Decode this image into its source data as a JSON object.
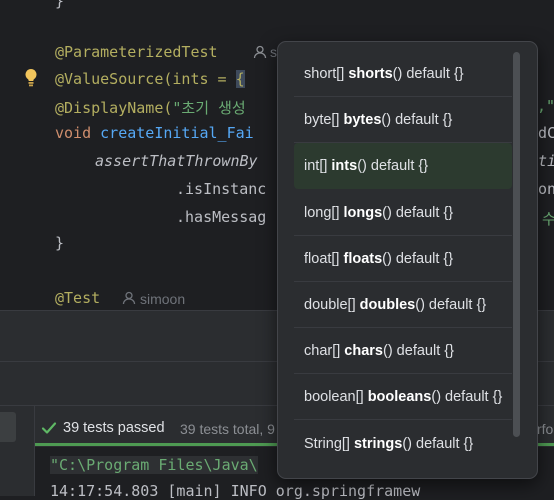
{
  "editor": {
    "lines": {
      "brace_close_top": "}",
      "param_test": "@ParameterizedTest",
      "value_source_prefix": "@ValueSource(ints = ",
      "value_source_brace": "{",
      "display_name_prefix": "@DisplayName(",
      "display_name_str": "\"초기 생성",
      "display_name_tail": ",\"",
      "void_kw": "void ",
      "method_name": "createInitial_Fai",
      "assert_call": "assertThatThrownBy",
      "is_instance": ".isInstanc",
      "has_message": ".hasMessag",
      "closing_brace": "}",
      "test_ann": "@Test",
      "frag_right_1": "dC",
      "frag_right_2": "ti",
      "frag_right_3": "on",
      "frag_right_4": "수"
    },
    "author_top": "s",
    "author_test": "simoon"
  },
  "popup": {
    "items": [
      {
        "prefix": "short[] ",
        "name": "shorts",
        "suffix": "() default {}"
      },
      {
        "prefix": "byte[] ",
        "name": "bytes",
        "suffix": "() default {}"
      },
      {
        "prefix": "int[] ",
        "name": "ints",
        "suffix": "() default {}"
      },
      {
        "prefix": "long[] ",
        "name": "longs",
        "suffix": "() default {}"
      },
      {
        "prefix": "float[] ",
        "name": "floats",
        "suffix": "() default {}"
      },
      {
        "prefix": "double[] ",
        "name": "doubles",
        "suffix": "() default {}"
      },
      {
        "prefix": "char[] ",
        "name": "chars",
        "suffix": "() default {}"
      },
      {
        "prefix": "boolean[] ",
        "name": "booleans",
        "suffix": "() default {}"
      },
      {
        "prefix": "String[] ",
        "name": "strings",
        "suffix": "() default {}"
      }
    ],
    "selected_index": 2
  },
  "test_panel": {
    "passed": "39 tests passed",
    "total": "39 tests total, 9",
    "right_frag": "rfo"
  },
  "console": {
    "line1": "\"C:\\Program Files\\Java\\",
    "line2": "14:17:54.803 [main] INFO org.springframew"
  },
  "colors": {
    "accent_green": "#4e9a52",
    "annotation": "#b3ae60",
    "keyword": "#cf8e6d",
    "function": "#56a8f5",
    "string": "#6aab73"
  }
}
